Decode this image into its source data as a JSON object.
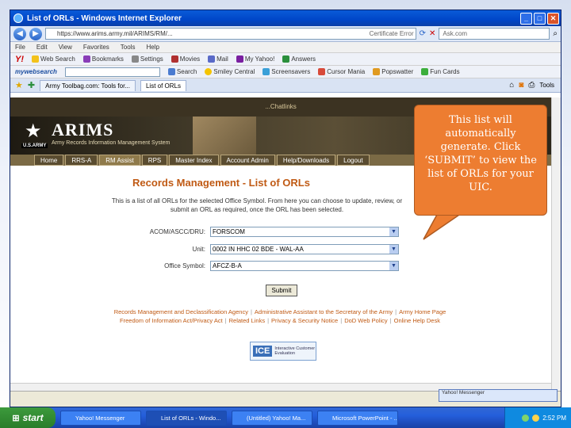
{
  "window": {
    "title": "List of ORLs - Windows Internet Explorer",
    "url": "https://www.arims.army.mil/ARIMS/RM/...",
    "cert_label": "Certificate Error",
    "search_placeholder": "Ask.com"
  },
  "menubar": [
    "File",
    "Edit",
    "View",
    "Favorites",
    "Tools",
    "Help"
  ],
  "toolbar": {
    "yahoo": "Y!",
    "web_search": "Web Search",
    "bookmarks": "Bookmarks",
    "settings": "Settings",
    "movies": "Movies",
    "mail": "Mail",
    "my_yahoo": "My Yahoo!",
    "answers": "Answers",
    "mywebsearch": "mywebsearch",
    "search": "Search",
    "smiley": "Smiley Central",
    "screensavers": "Screensavers",
    "cursor": "Cursor Mania",
    "popswatter": "Popswatter",
    "jokes": "Fun Cards"
  },
  "tabs": {
    "tab1": "Army Toolbag.com: Tools for...",
    "tab2": "List of ORLs",
    "tools": "Tools"
  },
  "site": {
    "top_strip": "...Chatlinks",
    "brand": "ARIMS",
    "brand_sub": "Army Records Information Management System",
    "usarmy": "U.S.ARMY",
    "nav": [
      "Home",
      "RRS-A",
      "RM Assist",
      "RPS",
      "Master Index",
      "Account Admin",
      "Help/Downloads",
      "Logout"
    ]
  },
  "page": {
    "title": "Records Management - List of ORLs",
    "intro": "This is a list of all ORLs for the selected Office Symbol. From here you can choose to update, review, or submit an ORL as required, once the ORL has been selected.",
    "acom_label": "ACOM/ASCC/DRU:",
    "acom_value": "FORSCOM",
    "unit_label": "Unit:",
    "unit_value": "0002 IN HHC 02 BDE - WAL-AA",
    "office_label": "Office Symbol:",
    "office_value": "AFCZ-B-A",
    "submit": "Submit"
  },
  "footer": {
    "row1": [
      "Records Management and Declassification Agency",
      "Administrative Assistant to the Secretary of the Army",
      "Army Home Page"
    ],
    "row2": [
      "Freedom of Information Act/Privacy Act",
      "Related Links",
      "Privacy & Security Notice",
      "DoD Web Policy",
      "Online Help Desk"
    ],
    "ice_logo": "ICE",
    "ice_text": "Interactive Customer Evaluation"
  },
  "statusbar": {
    "messenger": "Yahoo! Messenger"
  },
  "taskbar": {
    "start": "start",
    "items": [
      "Yahoo! Messenger",
      "List of ORLs - Windo...",
      "(Untitled) Yahoo! Ma...",
      "Microsoft PowerPoint - ..."
    ],
    "clock": "2:52 PM"
  },
  "callout": {
    "text": "This list will automatically generate. Click ‘SUBMIT’ to view the list of ORLs for your UIC."
  },
  "colors": {
    "callout": "#ed7d31",
    "title_orange": "#c05a14",
    "xp_blue": "#245edb"
  }
}
